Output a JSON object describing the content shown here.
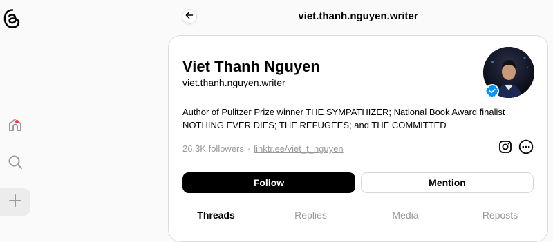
{
  "nav": {
    "logo_icon": "threads-logo-icon",
    "items": [
      "home-icon",
      "search-icon",
      "plus-icon"
    ],
    "has_notification": true,
    "notification_color": "#ff3040"
  },
  "header": {
    "title": "viet.thanh.nguyen.writer"
  },
  "profile": {
    "name": "Viet Thanh Nguyen",
    "handle": "viet.thanh.nguyen.writer",
    "verified": true,
    "verified_color": "#0095f6",
    "bio_lines": [
      "Author of Pulitzer Prize winner THE SYMPATHIZER; National Book Award finalist",
      "NOTHING EVER DIES; THE REFUGEES; and THE COMMITTED"
    ],
    "followers": "26.3K followers",
    "separator": "·",
    "link": "linktr.ee/viet_t_nguyen"
  },
  "actions": {
    "follow_label": "Follow",
    "mention_label": "Mention"
  },
  "tabs": [
    "Threads",
    "Replies",
    "Media",
    "Reposts"
  ],
  "active_tab": "Threads"
}
